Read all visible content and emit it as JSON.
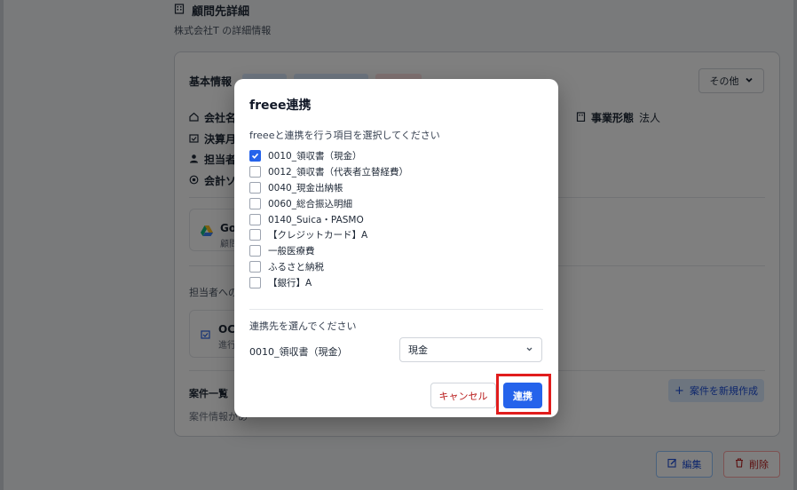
{
  "page": {
    "title": "顧問先詳細",
    "subtitle": "株式会社T の詳細情報"
  },
  "basic_info": {
    "title": "基本情報",
    "other_label": "その他",
    "company_name_label": "会社名",
    "fiscal_month_label": "決算月",
    "person_label": "担当者",
    "accounting_label": "会計ソ",
    "business_type_label": "事業形態",
    "business_type_value": "法人"
  },
  "google_card": {
    "title": "Goo",
    "subtitle": "顧問"
  },
  "assignee_label": "担当者へのC",
  "ocr_card": {
    "title": "OCR",
    "subtitle": "進行"
  },
  "cases": {
    "label": "案件一覧",
    "count": "0",
    "empty_text": "案件情報があ",
    "new_button": "案件を新規作成"
  },
  "actions": {
    "edit": "編集",
    "delete": "削除"
  },
  "modal": {
    "title": "freee連携",
    "description": "freeeと連携を行う項目を選択してください",
    "options": [
      {
        "label": "0010_領収書（現金）",
        "checked": true
      },
      {
        "label": "0012_領収書（代表者立替経費）",
        "checked": false
      },
      {
        "label": "0040_現金出納帳",
        "checked": false
      },
      {
        "label": "0060_総合振込明細",
        "checked": false
      },
      {
        "label": "0140_Suica・PASMO",
        "checked": false
      },
      {
        "label": "【クレジットカード】A",
        "checked": false
      },
      {
        "label": "一般医療費",
        "checked": false
      },
      {
        "label": "ふるさと納税",
        "checked": false
      },
      {
        "label": "【銀行】A",
        "checked": false
      }
    ],
    "destination_label": "連携先を選んでください",
    "destination_item": "0010_領収書（現金）",
    "destination_value": "現金",
    "cancel": "キャンセル",
    "connect": "連携"
  },
  "colors": {
    "primary": "#2563eb",
    "danger": "#b91c1c",
    "highlight": "#e11d1d"
  }
}
